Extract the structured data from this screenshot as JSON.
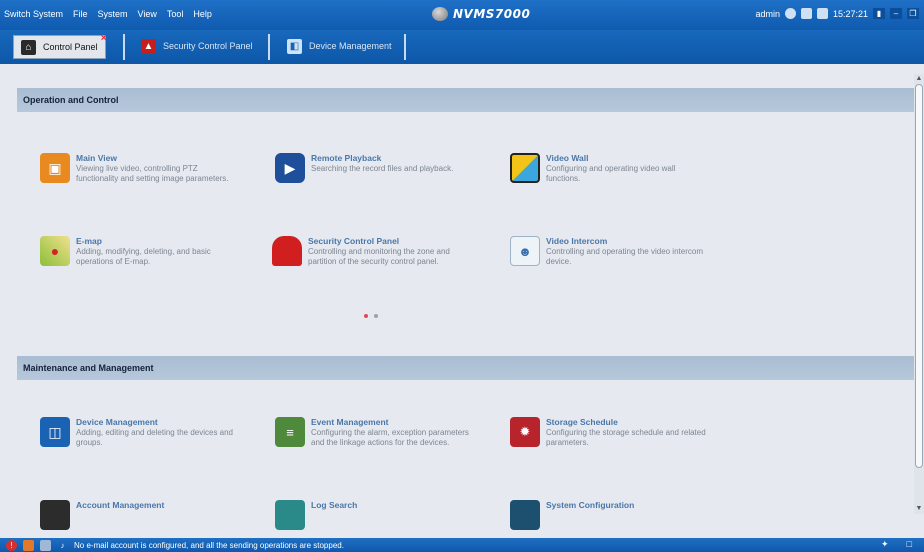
{
  "menu": [
    "Switch System",
    "File",
    "System",
    "View",
    "Tool",
    "Help"
  ],
  "app_title": "NVMS7000",
  "user": "admin",
  "time": "15:27:21",
  "tabs": [
    {
      "label": "Control Panel",
      "icon": "home-icon"
    },
    {
      "label": "Security Control Panel",
      "icon": "alarm-siren-icon"
    },
    {
      "label": "Device Management",
      "icon": "device-management-icon"
    }
  ],
  "sections": {
    "operation": {
      "title": "Operation and Control",
      "items": [
        {
          "name": "Main View",
          "desc": "Viewing live video, controlling PTZ functionality and setting image parameters.",
          "icon": "main-view-icon",
          "color": "#e88a1f"
        },
        {
          "name": "Remote Playback",
          "desc": "Searching the record files and playback.",
          "icon": "remote-playback-icon",
          "color": "#1f4f9a"
        },
        {
          "name": "Video Wall",
          "desc": "Configuring and operating video wall functions.",
          "icon": "video-wall-icon",
          "color": "#2b2b2b"
        },
        {
          "name": "E-map",
          "desc": "Adding, modifying, deleting, and basic operations of E-map.",
          "icon": "e-map-icon",
          "color": "#8cbf3a"
        },
        {
          "name": "Security Control Panel",
          "desc": "Controlling and monitoring the zone and partition of the security control panel.",
          "icon": "security-siren-icon",
          "color": "#d11f1f"
        },
        {
          "name": "Video Intercom",
          "desc": "Controlling and operating the video intercom device.",
          "icon": "video-intercom-icon",
          "color": "#3a6fb0"
        }
      ]
    },
    "maintenance": {
      "title": "Maintenance and Management",
      "items": [
        {
          "name": "Device Management",
          "desc": "Adding, editing and deleting the devices and groups.",
          "icon": "device-management-icon",
          "color": "#1a62b4"
        },
        {
          "name": "Event Management",
          "desc": "Configuring the alarm, exception parameters and the linkage actions for the devices.",
          "icon": "event-management-icon",
          "color": "#4f8a3c"
        },
        {
          "name": "Storage Schedule",
          "desc": "Configuring the storage schedule and related parameters.",
          "icon": "storage-schedule-icon",
          "color": "#b8242b"
        },
        {
          "name": "Account Management",
          "desc": "",
          "icon": "account-management-icon",
          "color": "#2c2c2c"
        },
        {
          "name": "Log Search",
          "desc": "",
          "icon": "log-search-icon",
          "color": "#2a8a8a"
        },
        {
          "name": "System Configuration",
          "desc": "",
          "icon": "system-configuration-icon",
          "color": "#1d4f6f"
        }
      ]
    }
  },
  "status": {
    "message": "No e-mail account is configured, and all the sending operations are stopped."
  }
}
